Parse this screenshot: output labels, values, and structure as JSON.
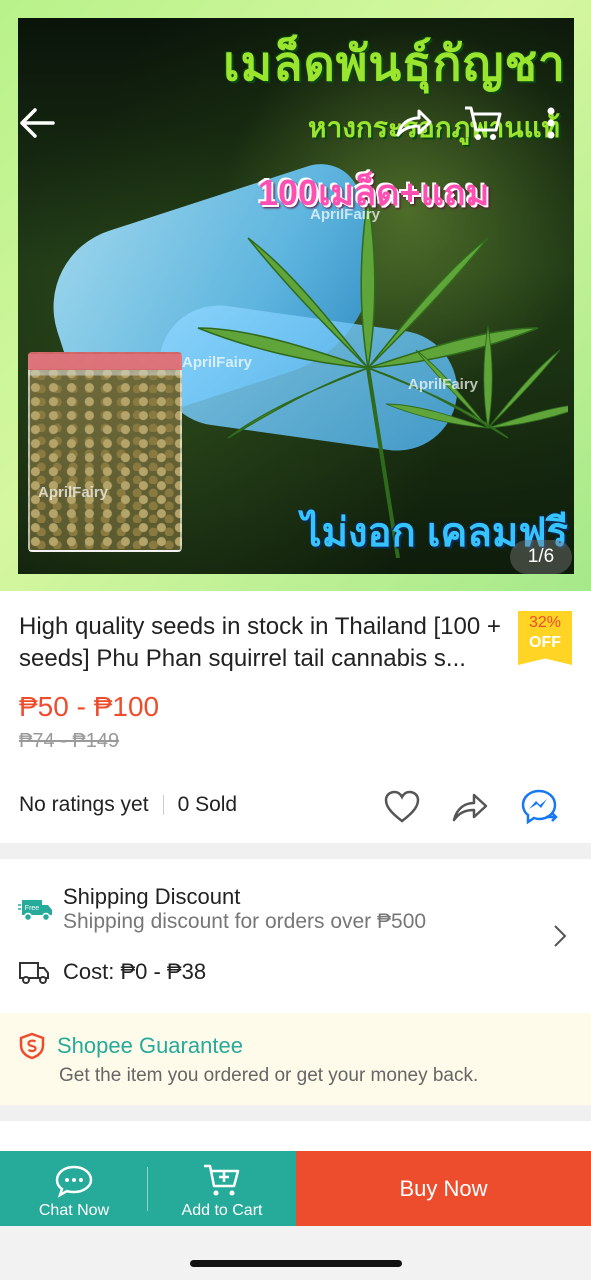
{
  "hero": {
    "title_th": "เมล็ดพันธุ์กัญชา",
    "subtitle_th": "หางกระรอกภูพานแท้",
    "badge_th": "100เมล็ด+แถม",
    "bottom_th": "ไม่งอก เคลมฟรี",
    "watermark": "AprilFairy",
    "image_counter": "1/6"
  },
  "nav": {
    "icons": [
      "back-arrow-icon",
      "share-icon",
      "cart-icon",
      "more-icon"
    ]
  },
  "product": {
    "title": "High quality seeds in stock in Thailand [100 + seeds] Phu Phan squirrel tail cannabis s...",
    "discount_percent": "32%",
    "discount_off": "OFF",
    "price": "₱50 - ₱100",
    "original_price": "₱74 - ₱149",
    "ratings": "No ratings yet",
    "sold": "0 Sold"
  },
  "shipping": {
    "badge": "Free",
    "title": "Shipping Discount",
    "subtitle": "Shipping discount for orders over ₱500",
    "cost": "Cost: ₱0 - ₱38"
  },
  "guarantee": {
    "title": "Shopee Guarantee",
    "subtitle": "Get the item you ordered or get your money back."
  },
  "bottom_bar": {
    "chat_label": "Chat Now",
    "cart_label": "Add to Cart",
    "buy_label": "Buy Now"
  },
  "colors": {
    "primary": "#ee4d2d",
    "teal": "#26aa99",
    "discount_tag": "#ffd424",
    "guarantee_bg": "#fffbea"
  }
}
